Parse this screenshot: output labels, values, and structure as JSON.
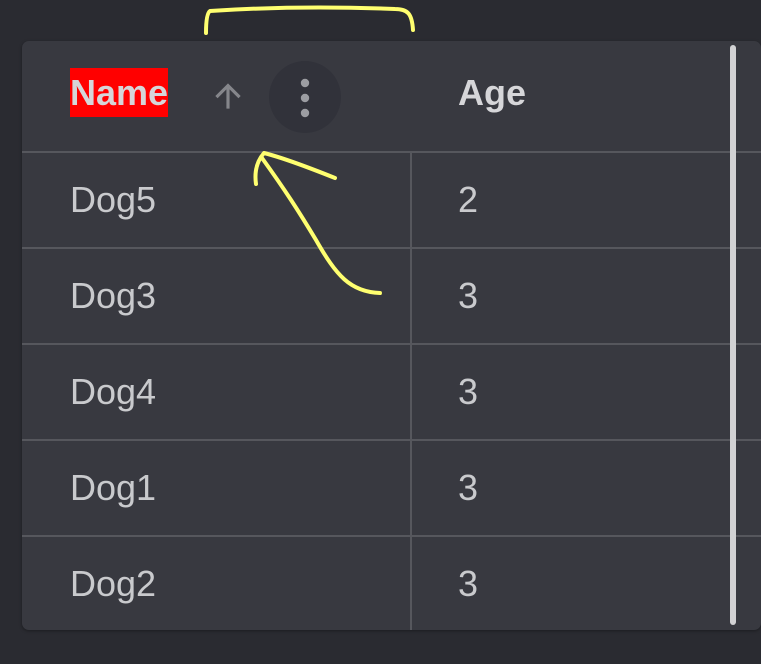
{
  "grid": {
    "columns": [
      {
        "header": "Name"
      },
      {
        "header": "Age"
      }
    ],
    "sort": {
      "column": "Name",
      "direction": "ascending"
    },
    "rows": [
      {
        "name": "Dog5",
        "age": "2"
      },
      {
        "name": "Dog3",
        "age": "3"
      },
      {
        "name": "Dog4",
        "age": "3"
      },
      {
        "name": "Dog1",
        "age": "3"
      },
      {
        "name": "Dog2",
        "age": "3"
      }
    ]
  },
  "icons": {
    "sort": "arrow-up-icon",
    "menu": "kebab-menu-icon"
  },
  "colors": {
    "background": "#2a2b31",
    "grid_background": "#383940",
    "header_highlight": "#ff0000",
    "annotation": "#ffff70"
  }
}
